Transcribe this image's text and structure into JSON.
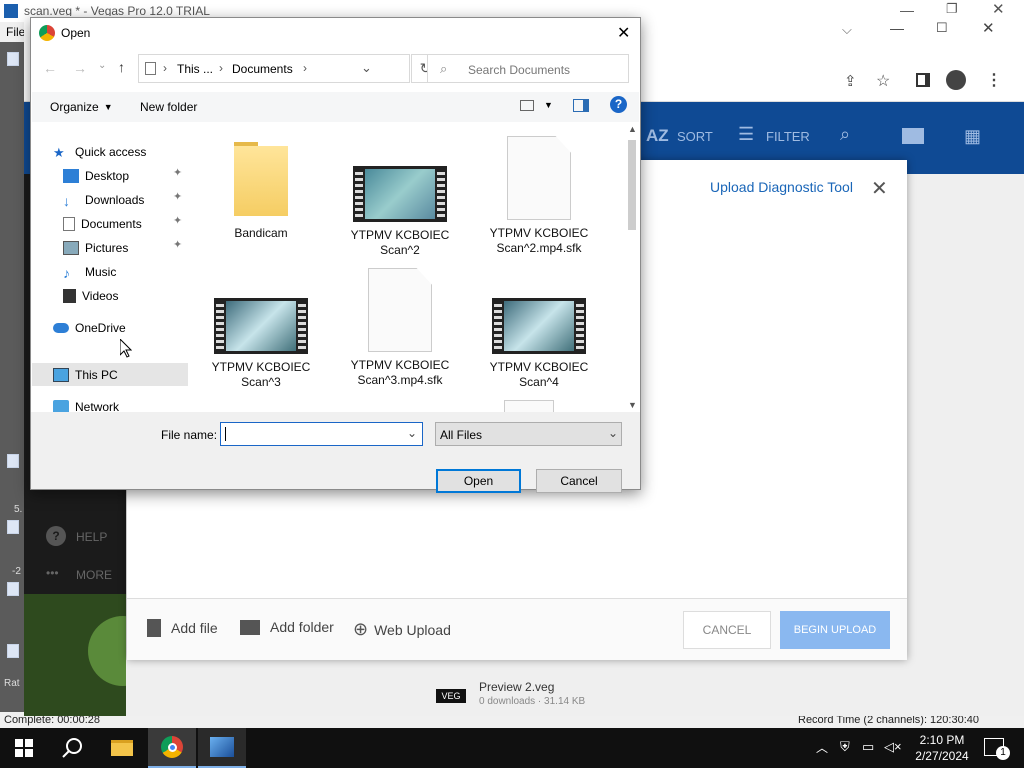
{
  "vegas": {
    "title": "scan.veg * - Vegas Pro 12.0 TRIAL",
    "menu_first": "File",
    "status_left": "Complete: 00:00:28",
    "status_right": "Record Time (2 channels): 120:30:40",
    "side_labels": [
      "5.",
      "-2",
      "Rat"
    ]
  },
  "chrome": {
    "header": {
      "sort_label": "SORT",
      "filter_label": "FILTER"
    },
    "sidebar": {
      "help_label": "HELP",
      "more_label": "MORE"
    },
    "list": {
      "last_item_title": "Preview 2.veg",
      "last_item_meta": "0 downloads · 31.14 KB",
      "badge": "VEG"
    }
  },
  "upload": {
    "title": "Upload Diagnostic Tool",
    "add_file": "Add file",
    "add_folder": "Add folder",
    "web_upload": "Web Upload",
    "cancel": "CANCEL",
    "begin": "BEGIN UPLOAD"
  },
  "dialog": {
    "title": "Open",
    "breadcrumb": [
      "This ...",
      "Documents"
    ],
    "search_placeholder": "Search Documents",
    "organize": "Organize",
    "new_folder": "New folder",
    "help_glyph": "?",
    "nav": [
      {
        "label": "Quick access",
        "pinned": false,
        "indent": 0
      },
      {
        "label": "Desktop",
        "pinned": true,
        "indent": 1
      },
      {
        "label": "Downloads",
        "pinned": true,
        "indent": 1
      },
      {
        "label": "Documents",
        "pinned": true,
        "indent": 1
      },
      {
        "label": "Pictures",
        "pinned": true,
        "indent": 1
      },
      {
        "label": "Music",
        "pinned": false,
        "indent": 1
      },
      {
        "label": "Videos",
        "pinned": false,
        "indent": 1
      },
      {
        "label": "OneDrive",
        "pinned": false,
        "indent": 0
      },
      {
        "label": "This PC",
        "pinned": false,
        "indent": 0
      },
      {
        "label": "Network",
        "pinned": false,
        "indent": 0
      }
    ],
    "files": [
      {
        "line1": "Bandicam",
        "line2": "",
        "kind": "folder"
      },
      {
        "line1": "YTPMV KCBOIEC",
        "line2": "Scan^2",
        "kind": "video"
      },
      {
        "line1": "YTPMV KCBOIEC",
        "line2": "Scan^2.mp4.sfk",
        "kind": "doc"
      },
      {
        "line1": "YTPMV KCBOIEC",
        "line2": "Scan^3",
        "kind": "video"
      },
      {
        "line1": "YTPMV KCBOIEC",
        "line2": "Scan^3.mp4.sfk",
        "kind": "doc"
      },
      {
        "line1": "YTPMV KCBOIEC",
        "line2": "Scan^4",
        "kind": "video"
      }
    ],
    "file_name_label": "File name:",
    "file_name_value": "",
    "filter": "All Files",
    "open_button": "Open",
    "cancel_button": "Cancel"
  },
  "taskbar": {
    "time": "2:10 PM",
    "date": "2/27/2024",
    "notifications": "1"
  },
  "colors": {
    "app_blue": "#0f4a94",
    "link_blue": "#1a73e8",
    "begin_upload": "#8ab8f0",
    "selection": "#e5e5e5"
  }
}
